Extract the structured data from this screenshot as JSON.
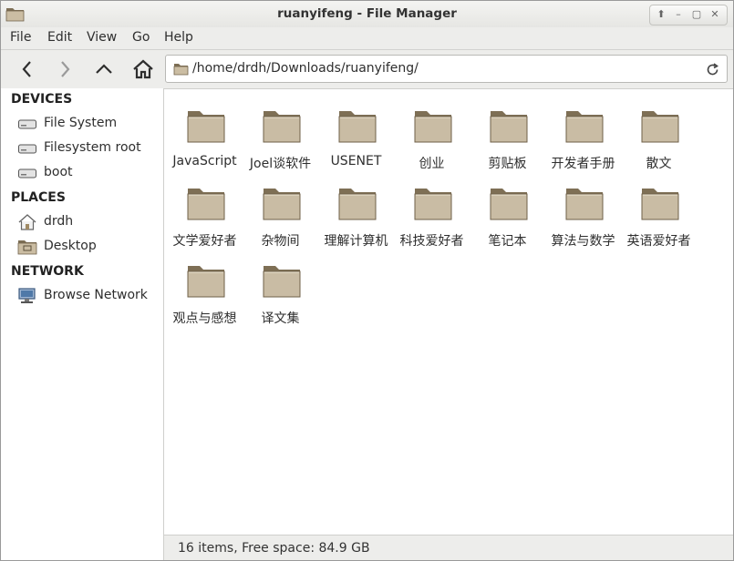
{
  "window": {
    "title": "ruanyifeng - File Manager"
  },
  "menu": [
    {
      "label": "File"
    },
    {
      "label": "Edit"
    },
    {
      "label": "View"
    },
    {
      "label": "Go"
    },
    {
      "label": "Help"
    }
  ],
  "toolbar": {
    "back_icon": "chevron-left-icon",
    "forward_icon": "chevron-right-icon",
    "up_icon": "chevron-up-icon",
    "home_icon": "home-icon",
    "reload_icon": "reload-icon"
  },
  "location": {
    "path": "/home/drdh/Downloads/ruanyifeng/"
  },
  "sidebar": {
    "devices_header": "DEVICES",
    "devices": [
      {
        "label": "File System",
        "icon": "drive-icon"
      },
      {
        "label": "Filesystem root",
        "icon": "drive-icon"
      },
      {
        "label": "boot",
        "icon": "drive-icon"
      }
    ],
    "places_header": "PLACES",
    "places": [
      {
        "label": "drdh",
        "icon": "home-icon"
      },
      {
        "label": "Desktop",
        "icon": "desktop-folder-icon"
      }
    ],
    "network_header": "NETWORK",
    "network": [
      {
        "label": "Browse Network",
        "icon": "network-icon"
      }
    ]
  },
  "files": [
    {
      "name": "JavaScript"
    },
    {
      "name": "Joel谈软件"
    },
    {
      "name": "USENET"
    },
    {
      "name": "创业"
    },
    {
      "name": "剪贴板"
    },
    {
      "name": "开发者手册"
    },
    {
      "name": "散文"
    },
    {
      "name": "文学爱好者"
    },
    {
      "name": "杂物间"
    },
    {
      "name": "理解计算机"
    },
    {
      "name": "科技爱好者"
    },
    {
      "name": "笔记本"
    },
    {
      "name": "算法与数学"
    },
    {
      "name": "英语爱好者"
    },
    {
      "name": "观点与感想"
    },
    {
      "name": "译文集"
    }
  ],
  "status": {
    "text": "16 items, Free space: 84.9 GB"
  },
  "colors": {
    "folder_body": "#c9bca4",
    "folder_dark": "#7e6f55",
    "accent": "#3c6ea5"
  }
}
